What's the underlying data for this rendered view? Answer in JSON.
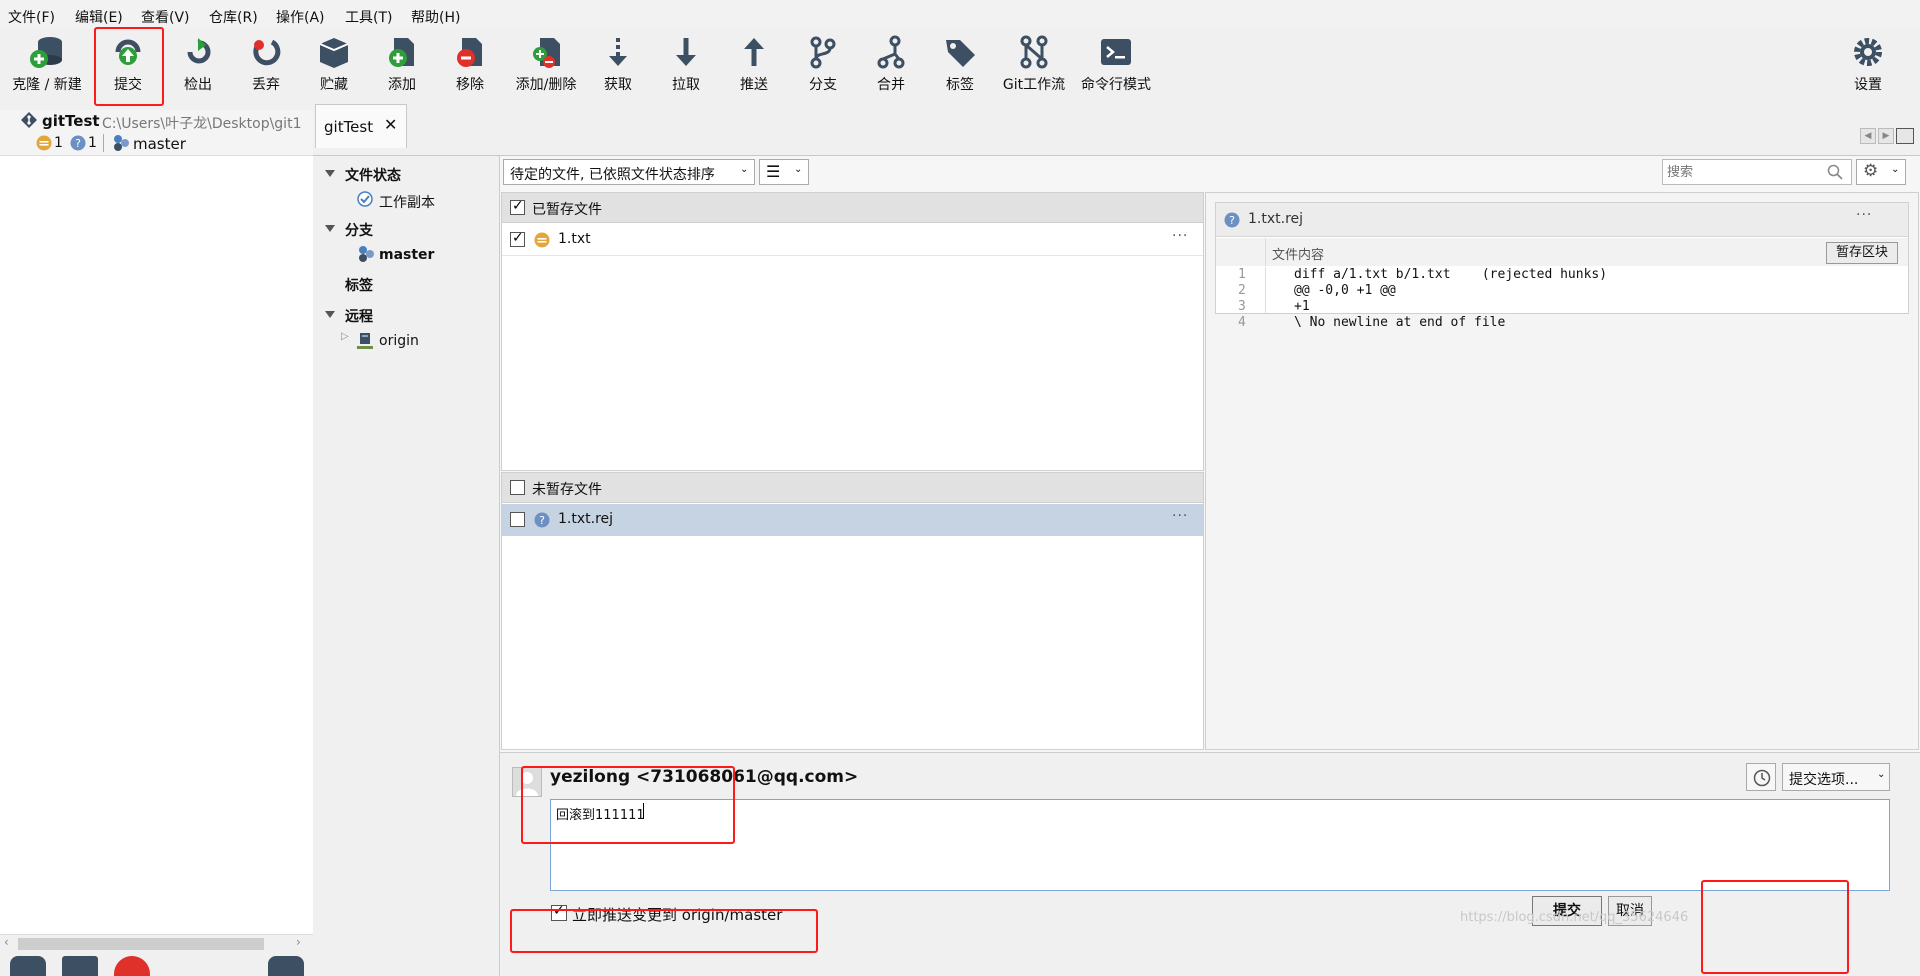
{
  "menu": [
    "文件(F)",
    "编辑(E)",
    "查看(V)",
    "仓库(R)",
    "操作(A)",
    "工具(T)",
    "帮助(H)"
  ],
  "toolbar": {
    "clone": "克隆 / 新建",
    "commit": "提交",
    "checkout": "检出",
    "discard": "丢弃",
    "stash": "贮藏",
    "add": "添加",
    "remove": "移除",
    "add_remove": "添加/删除",
    "fetch": "获取",
    "pull": "拉取",
    "push": "推送",
    "branch": "分支",
    "merge": "合并",
    "tag": "标签",
    "gitflow": "Git工作流",
    "terminal": "命令行模式",
    "settings": "设置"
  },
  "repo": {
    "name": "gitTest",
    "path": "C:\\Users\\叶子龙\\Desktop\\git1",
    "modified_count": "1",
    "untracked_count": "1",
    "branch": "master"
  },
  "tab": {
    "label": "gitTest"
  },
  "sidebar": {
    "file_status": "文件状态",
    "working_copy": "工作副本",
    "branches": "分支",
    "branch_master": "master",
    "tags": "标签",
    "remotes": "远程",
    "remote_origin": "origin"
  },
  "filter": {
    "sort_label": "待定的文件, 已依照文件状态排序",
    "search_placeholder": "搜索"
  },
  "staged": {
    "title": "已暂存文件",
    "files": [
      {
        "name": "1.txt"
      }
    ]
  },
  "unstaged": {
    "title": "未暂存文件",
    "files": [
      {
        "name": "1.txt.rej"
      }
    ]
  },
  "diff": {
    "file": "1.txt.rej",
    "section": "文件内容",
    "stage_hunk": "暂存区块",
    "lines": [
      {
        "no": "1",
        "text": "diff a/1.txt b/1.txt    (rejected hunks)"
      },
      {
        "no": "2",
        "text": "@@ -0,0 +1 @@"
      },
      {
        "no": "3",
        "text": "+1"
      },
      {
        "no": "4",
        "text": "\\ No newline at end of file"
      }
    ]
  },
  "commit": {
    "author": "yezilong <731068061@qq.com>",
    "message": "回滚到111111",
    "options": "提交选项...",
    "push_label": "立即推送变更到 origin/master",
    "commit_button": "提交",
    "cancel_button": "取消"
  },
  "watermark": "https://blog.csdn.net/qq_35624646",
  "colors": {
    "highlight": "#ff1a1a",
    "selected_row": "#c5d3e3",
    "accent_blue": "#2f6db5"
  }
}
